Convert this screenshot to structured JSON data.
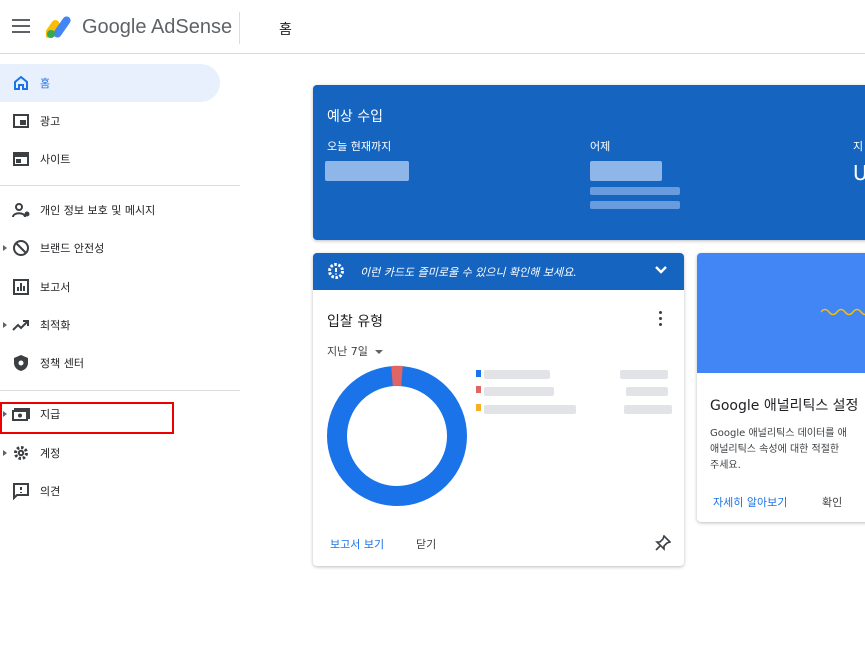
{
  "header": {
    "brand": "Google AdSense",
    "page_title": "홈",
    "menu_icon": "hamburger-menu-icon",
    "logo_icon": "adsense-logo-icon"
  },
  "sidebar": {
    "items": [
      {
        "label": "홈",
        "icon": "home-icon",
        "active": true
      },
      {
        "label": "광고",
        "icon": "ads-icon"
      },
      {
        "label": "사이트",
        "icon": "sites-icon"
      },
      {
        "label": "개인 정보 보호 및 메시지",
        "icon": "privacy-icon"
      },
      {
        "label": "브랜드 안전성",
        "icon": "block-icon",
        "expandable": true
      },
      {
        "label": "보고서",
        "icon": "bar-chart-icon"
      },
      {
        "label": "최적화",
        "icon": "trending-up-icon",
        "expandable": true
      },
      {
        "label": "정책 센터",
        "icon": "shield-icon"
      },
      {
        "label": "지급",
        "icon": "payments-icon",
        "expandable": true,
        "highlighted": true
      },
      {
        "label": "계정",
        "icon": "gear-icon",
        "expandable": true
      },
      {
        "label": "의견",
        "icon": "feedback-icon"
      }
    ]
  },
  "earnings": {
    "title": "예상 수입",
    "columns": [
      "오늘 현재까지",
      "어제",
      "지"
    ],
    "cut_value": "U",
    "accent": "#1565c0"
  },
  "bid_card": {
    "banner": "이런 카드도 즐미로울 수 있으니 확인해 보세요.",
    "title": "입찰 유형",
    "period": "지난 7일",
    "view_report": "보고서 보기",
    "close": "닫기",
    "legend_colors": [
      "#1a73e8",
      "#e06666",
      "#f6b026"
    ]
  },
  "analytics_card": {
    "title": "Google 애널리틱스 설정",
    "body": [
      "Google 애널리틱스 데이터를 애",
      "애널리틱스 속성에 대한 적절한",
      "주세요."
    ],
    "learn_more": "자세히 알아보기",
    "confirm": "확인"
  }
}
